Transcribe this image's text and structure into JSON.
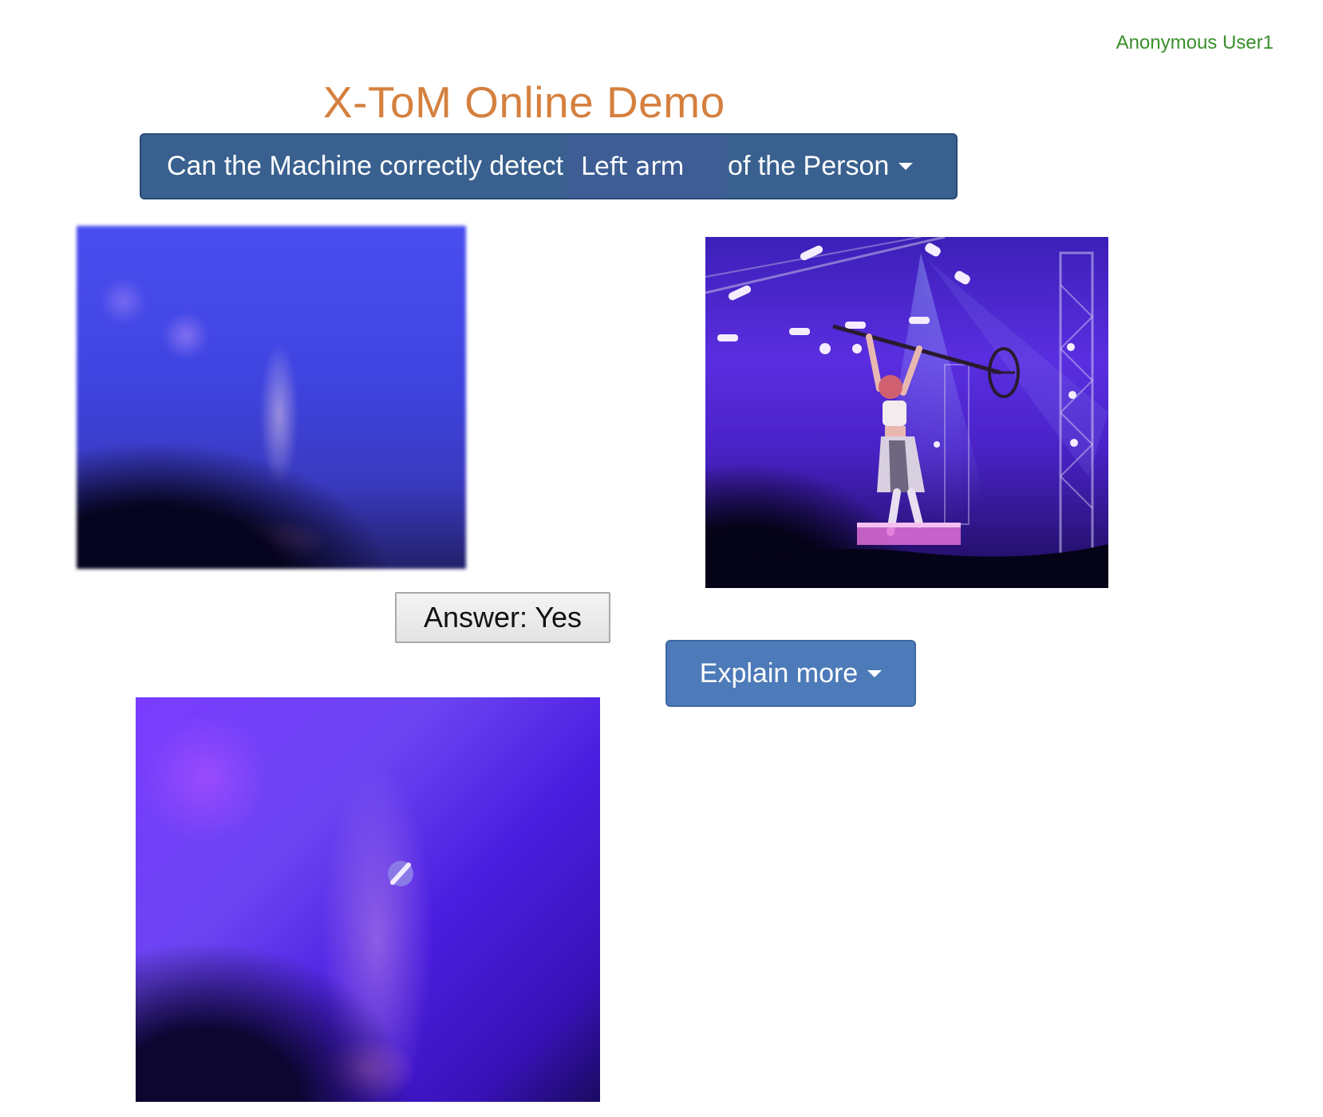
{
  "header": {
    "user_label": "Anonymous User1",
    "title": "X-ToM Online Demo"
  },
  "question": {
    "prefix": "Can the Machine correctly detect",
    "selected_part": "Left arm",
    "suffix": "of the Person",
    "caret_icon": "caret-down-icon"
  },
  "answer": {
    "label": "Answer: Yes"
  },
  "explain": {
    "label": "Explain more",
    "caret_icon": "caret-down-icon"
  },
  "colors": {
    "title": "#d5803f",
    "user": "#3a8f2c",
    "question_button": "#39608f",
    "explain_button": "#4d7ab8"
  }
}
